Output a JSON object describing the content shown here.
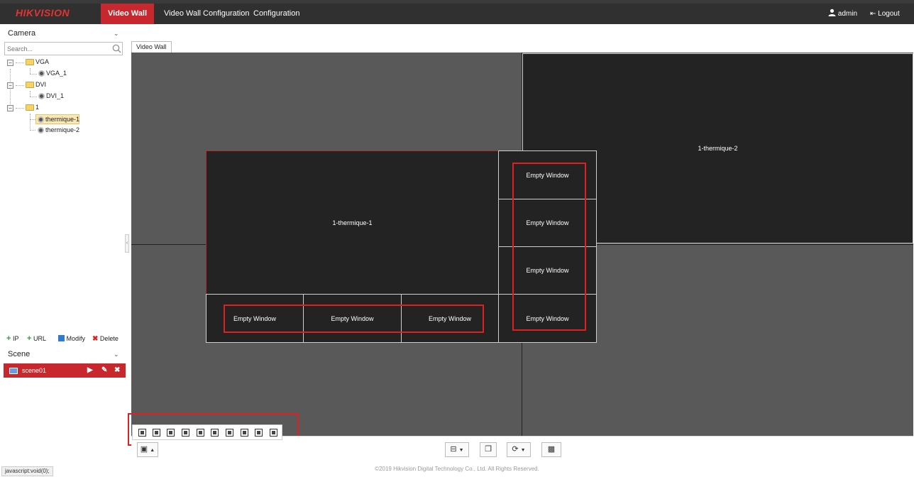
{
  "header": {
    "logo": "HIKVISION",
    "nav": [
      "Video Wall",
      "Video Wall Configuration",
      "Configuration"
    ],
    "user": "admin",
    "logout": "Logout"
  },
  "sidebar": {
    "camera_title": "Camera",
    "search_placeholder": "Search...",
    "tree": {
      "vga": "VGA",
      "vga_1": "VGA_1",
      "dvi": "DVI",
      "dvi_1": "DVI_1",
      "group1": "1",
      "cam1": "thermique-1",
      "cam2": "thermique-2"
    },
    "actions": {
      "ip": "IP",
      "url": "URL",
      "modify": "Modify",
      "delete": "Delete"
    },
    "scene_title": "Scene",
    "scene_item": "scene01"
  },
  "main": {
    "tab": "Video Wall",
    "windows": {
      "main1": "1-thermique-1",
      "main2": "1-thermique-2",
      "empty": "Empty Window"
    }
  },
  "footer": "©2019 Hikvision Digital Technology Co., Ltd. All Rights Reserved.",
  "statusbar": "javascript:void(0);",
  "colors": {
    "accent": "#c8282d",
    "highlight": "#e02020",
    "wall_bg": "#595959",
    "window_bg": "#232323"
  }
}
